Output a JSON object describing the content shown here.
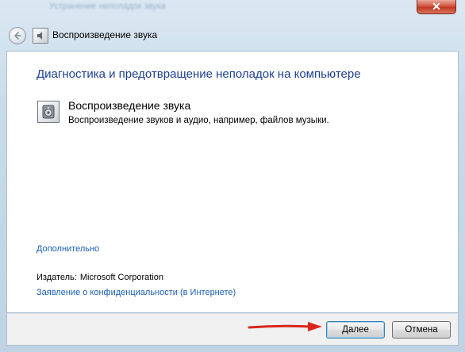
{
  "window": {
    "blurred_caption": "Устранение неполадок звука",
    "close_symbol": "✕"
  },
  "nav": {
    "title": "Воспроизведение звука"
  },
  "main": {
    "heading": "Диагностика и предотвращение неполадок на компьютере",
    "item_title": "Воспроизведение звука",
    "item_description": "Воспроизведение звуков и аудио, например, файлов музыки.",
    "advanced_link": "Дополнительно",
    "publisher_label": "Издатель:",
    "publisher_value": "Microsoft Corporation",
    "privacy_link": "Заявление о конфиденциальности (в Интернете)"
  },
  "footer": {
    "next_label": "Далее",
    "cancel_label": "Отмена"
  },
  "colors": {
    "heading": "#1e3f8f",
    "link": "#1a5fb4",
    "annotation_arrow": "#d9261c"
  }
}
